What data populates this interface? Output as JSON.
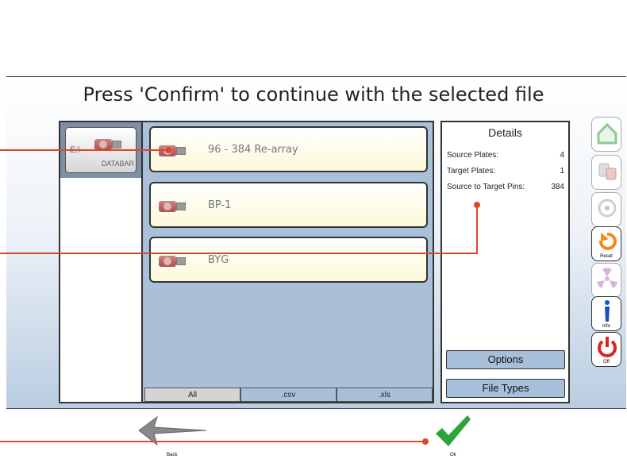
{
  "title": "Press 'Confirm' to continue with the selected file",
  "drive": {
    "letter": "E:\\",
    "label": "DATABAR"
  },
  "files": [
    {
      "name": "96 - 384 Re-array"
    },
    {
      "name": "BP-1"
    },
    {
      "name": "BYG"
    }
  ],
  "filters": {
    "all": "All",
    "csv": ".csv",
    "xls": ".xls"
  },
  "details": {
    "title": "Details",
    "rows": [
      {
        "label": "Source Plates:",
        "value": "4"
      },
      {
        "label": "Target Plates:",
        "value": "1"
      },
      {
        "label": "Source to Target Pins:",
        "value": "384"
      }
    ],
    "options_label": "Options",
    "file_types_label": "File Types"
  },
  "sidebar": {
    "home": "",
    "reagents": "",
    "refresh": "",
    "reset": "Reset",
    "radiation": "",
    "info": "Info",
    "off": "Off"
  },
  "bottom": {
    "back_label": "Back",
    "ok_label": "Ok"
  },
  "colors": {
    "accent": "#d84a2a",
    "panel": "#aac0d8",
    "check": "#2fa43a",
    "power": "#e02222"
  }
}
